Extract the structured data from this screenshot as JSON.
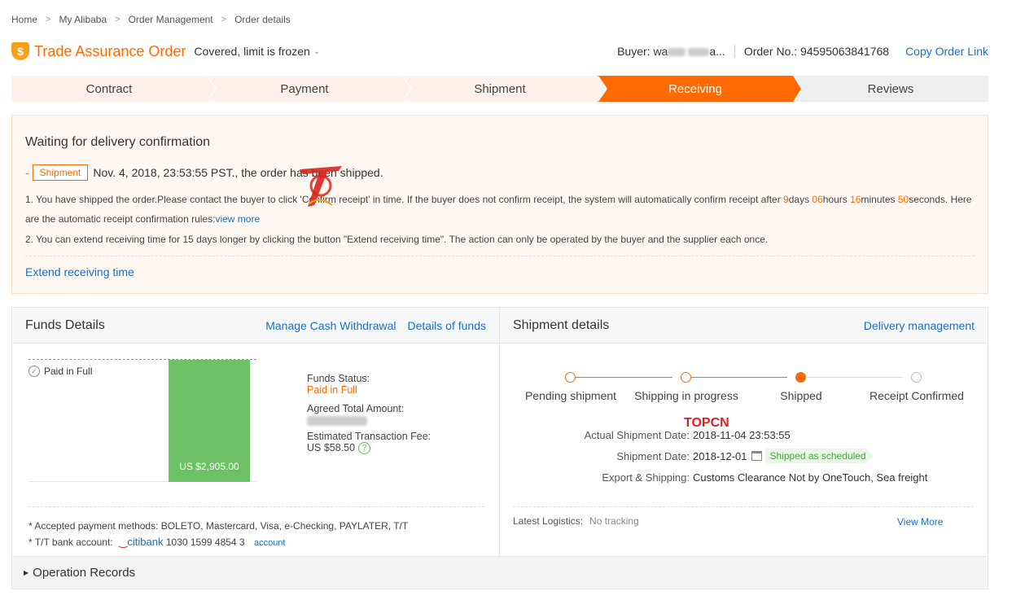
{
  "breadcrumb": [
    "Home",
    "My Alibaba",
    "Order Management",
    "Order details"
  ],
  "header": {
    "title": "Trade Assurance Order",
    "status": "Covered, limit is frozen",
    "buyer_label": "Buyer: wa",
    "buyer_tail": "a...",
    "order_no": "Order No.: 94595063841768",
    "copy_link": "Copy Order Link"
  },
  "steps": [
    "Contract",
    "Payment",
    "Shipment",
    "Receiving",
    "Reviews"
  ],
  "active_step": "Receiving",
  "notice": {
    "title": "Waiting for delivery confirmation",
    "tag": "Shipment",
    "shipped_text": "Nov. 4, 2018, 23:53:55 PST., the order has been shipped.",
    "rule1_a": "1. You have shipped the order.Please contact the buyer to click 'Confirm receipt' in time. If the buyer does not confirm receipt, the system will automatically confirm receipt after ",
    "days": "9",
    "days_label": "days ",
    "hours": "06",
    "hours_label": "hours ",
    "minutes": "16",
    "minutes_label": "minutes ",
    "seconds": "50",
    "rule1_b": "seconds. Here are the automatic receipt confirmation rules:",
    "view_more": "view more",
    "rule2": "2. You can extend receiving time for 15 days longer by clicking the button \"Extend receiving time\". The action can only be operated by the buyer and the supplier each once.",
    "extend": "Extend receiving time"
  },
  "funds": {
    "title": "Funds Details",
    "link_withdraw": "Manage Cash Withdrawal",
    "link_details": "Details of funds",
    "paid_label": "Paid in Full",
    "bar_amount": "US $2,905.00",
    "status_label": "Funds Status:",
    "status_value": "Paid in Full",
    "agreed_label": "Agreed Total Amount:",
    "fee_label": "Estimated Transaction Fee:",
    "fee_value": "US $58.50",
    "methods": "* Accepted payment methods: BOLETO, Mastercard, Visa, e-Checking, PAYLATER, T/T",
    "tt_label": "* T/T bank account:",
    "bank_name": "citibank",
    "bank_account": "1030 1599 4854 3",
    "account_link": "account"
  },
  "shipment": {
    "title": "Shipment details",
    "link": "Delivery management",
    "progress": [
      "Pending shipment",
      "Shipping in progress",
      "Shipped",
      "Receipt Confirmed"
    ],
    "current_index": 2,
    "actual_label": "Actual Shipment Date:",
    "actual_value": "2018-11-04 23:53:55",
    "date_label": "Shipment Date:",
    "date_value": "2018-12-01",
    "scheduled_badge": "Shipped as scheduled",
    "export_label": "Export & Shipping:",
    "export_value": "Customs Clearance Not by OneTouch, Sea freight",
    "logistics_label": "Latest Logistics:",
    "logistics_value": "No tracking",
    "view_more": "View More",
    "watermark": "TOPCN"
  },
  "operation_records": "Operation Records",
  "colors": {
    "accent": "#ff6a00",
    "link": "#1a6fc4",
    "paid_bar": "#6cc165"
  }
}
